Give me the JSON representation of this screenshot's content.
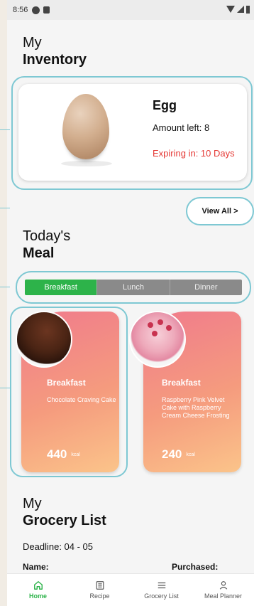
{
  "status_bar": {
    "time": "8:56"
  },
  "inventory": {
    "heading_line1": "My",
    "heading_line2": "Inventory",
    "item": {
      "name": "Egg",
      "amount": "Amount left: 8",
      "expiring": "Expiring in: 10 Days"
    },
    "view_all": "View All >"
  },
  "meal": {
    "heading_line1": "Today's",
    "heading_line2": "Meal",
    "tabs": [
      "Breakfast",
      "Lunch",
      "Dinner"
    ],
    "active_tab": "Breakfast",
    "cards": [
      {
        "type": "Breakfast",
        "name": "Chocolate Craving Cake",
        "kcal": "440",
        "unit": "kcal"
      },
      {
        "type": "Breakfast",
        "name": "Raspberry Pink Velvet Cake with Raspberry Cream Cheese Frosting",
        "kcal": "240",
        "unit": "kcal"
      }
    ]
  },
  "grocery": {
    "heading_line1": "My",
    "heading_line2": "Grocery List",
    "deadline": "Deadline: 04 - 05",
    "col_name": "Name:",
    "col_purchased": "Purchased:"
  },
  "nav": [
    {
      "label": "Home",
      "icon": "home-icon"
    },
    {
      "label": "Recipe",
      "icon": "recipe-icon"
    },
    {
      "label": "Grocery List",
      "icon": "list-icon"
    },
    {
      "label": "Meal Planner",
      "icon": "person-icon"
    }
  ],
  "colors": {
    "accent": "#2db34a",
    "expiring": "#e53935",
    "outline": "#7ec8d3"
  }
}
